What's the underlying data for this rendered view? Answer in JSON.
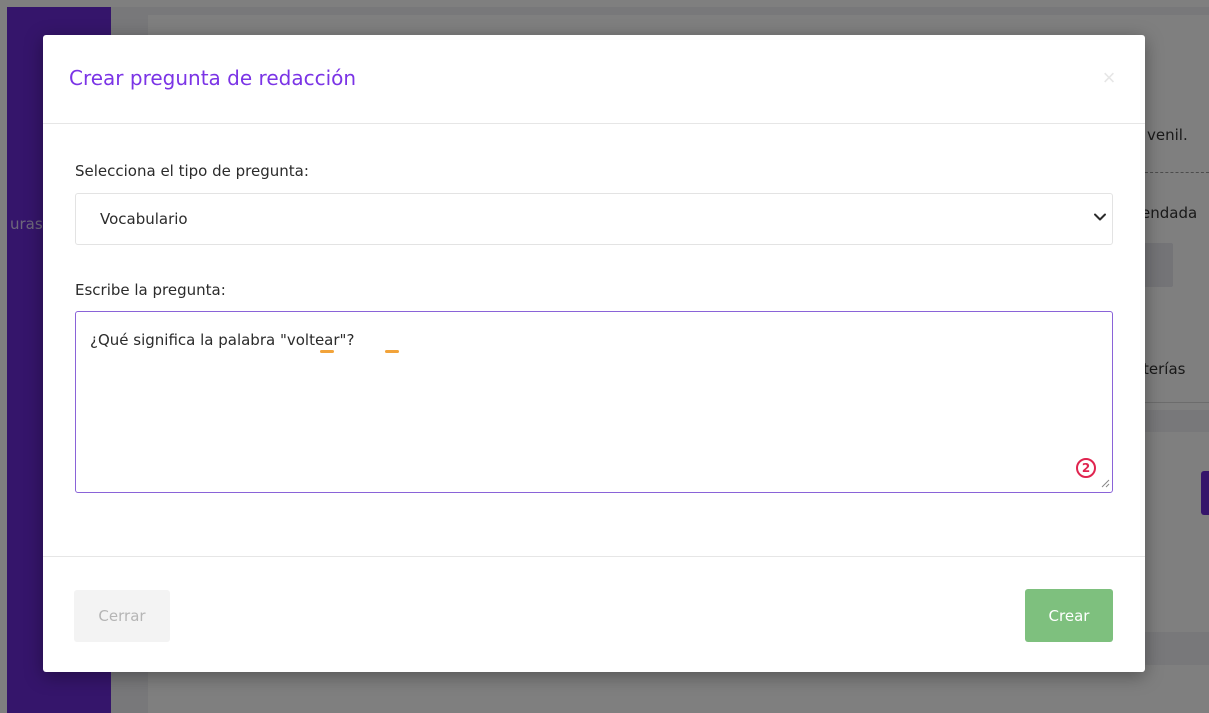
{
  "background": {
    "sidebar_text": "uras",
    "main_texts": {
      "juvenil": "venil.",
      "recomendada": "endada",
      "chip": ")",
      "categorias": "terías"
    }
  },
  "modal": {
    "title": "Crear pregunta de redacción",
    "close_label": "×",
    "type_label": "Selecciona el tipo de pregunta:",
    "type_value": "Vocabulario",
    "question_label": "Escribe la pregunta:",
    "question_text": "¿Qué significa la palabra \"voltear\"?",
    "spell_issues_count": "2",
    "buttons": {
      "close": "Cerrar",
      "create": "Crear"
    }
  },
  "colors": {
    "accent": "#7b34e6",
    "sidebar": "#6a2ad6",
    "create_button": "#7ec07e",
    "badge": "#e0244f",
    "spell_underline": "#f2a33a"
  }
}
